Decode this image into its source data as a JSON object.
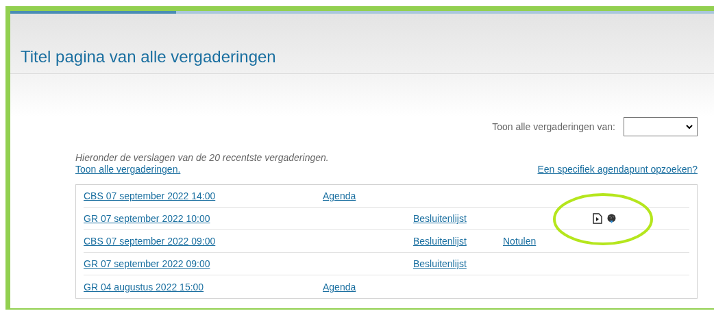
{
  "page": {
    "title": "Titel pagina van alle vergaderingen"
  },
  "loading_bar": {
    "level": 0.236
  },
  "filter": {
    "label": "Toon alle vergaderingen van:"
  },
  "intro": {
    "text": "Hieronder de verslagen van de 20 recentste vergaderingen.",
    "all_link": "Toon alle vergaderingen.",
    "search_link": "Een specifiek agendapunt opzoeken?"
  },
  "meetings": [
    {
      "name": "CBS 07 september 2022 14:00",
      "agenda": "Agenda"
    },
    {
      "name": "GR 07 september 2022 10:00",
      "besluitenlijst": "Besluitenlijst",
      "media": [
        {
          "kind": "video"
        },
        {
          "kind": "globe"
        }
      ],
      "highlighted": true
    },
    {
      "name": "CBS 07 september 2022 09:00",
      "besluitenlijst": "Besluitenlijst",
      "notulen": "Notulen"
    },
    {
      "name": "GR 07 september 2022 09:00",
      "besluitenlijst": "Besluitenlijst"
    },
    {
      "name": "GR 04 augustus 2022 15:00",
      "agenda": "Agenda"
    }
  ]
}
